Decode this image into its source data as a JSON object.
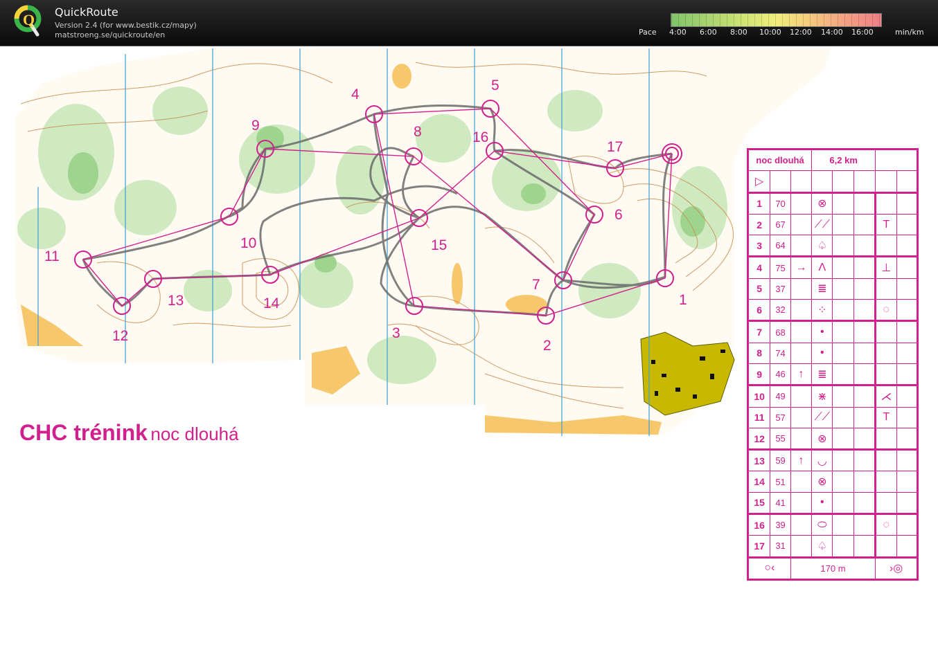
{
  "app": {
    "name": "QuickRoute",
    "version": "Version 2.4  (for www.bestik.cz/mapy)",
    "url": "matstroeng.se/quickroute/en"
  },
  "pace_legend": {
    "label": "Pace",
    "ticks": [
      "4:00",
      "6:00",
      "8:00",
      "10:00",
      "12:00",
      "14:00",
      "16:00"
    ],
    "unit": "min/km",
    "colors": [
      "#7fc46a",
      "#a7d36f",
      "#cde474",
      "#f1ee7c",
      "#f6c97e",
      "#f3a083",
      "#ee7f86"
    ]
  },
  "map": {
    "title_main": "CHC trénink",
    "title_sub": "noc dlouhá",
    "course_color": "#d11f8d",
    "controls": [
      "1",
      "2",
      "3",
      "4",
      "5",
      "6",
      "7",
      "8",
      "9",
      "10",
      "11",
      "12",
      "13",
      "14",
      "15",
      "16",
      "17"
    ]
  },
  "description": {
    "course_name": "noc dlouhá",
    "length": "6,2 km",
    "start_symbol": "▷",
    "rows": [
      {
        "n": "1",
        "code": "70",
        "dir": "",
        "feature": "⊗",
        "detail": ""
      },
      {
        "n": "2",
        "code": "67",
        "dir": "",
        "feature": "⟋⟋",
        "detail": "T"
      },
      {
        "n": "3",
        "code": "64",
        "dir": "",
        "feature": "♤",
        "detail": ""
      },
      {
        "n": "4",
        "code": "75",
        "dir": "→",
        "feature": "Λ",
        "detail": "⊥"
      },
      {
        "n": "5",
        "code": "37",
        "dir": "",
        "feature": "≣",
        "detail": ""
      },
      {
        "n": "6",
        "code": "32",
        "dir": "",
        "feature": "⁘",
        "detail": "◌"
      },
      {
        "n": "7",
        "code": "68",
        "dir": "",
        "feature": "•",
        "detail": ""
      },
      {
        "n": "8",
        "code": "74",
        "dir": "",
        "feature": "•",
        "detail": ""
      },
      {
        "n": "9",
        "code": "46",
        "dir": "↑",
        "feature": "≣",
        "detail": ""
      },
      {
        "n": "10",
        "code": "49",
        "dir": "",
        "feature": "⋇",
        "detail": "⋌"
      },
      {
        "n": "11",
        "code": "57",
        "dir": "",
        "feature": "⟋⟋",
        "detail": "T"
      },
      {
        "n": "12",
        "code": "55",
        "dir": "",
        "feature": "⊗",
        "detail": ""
      },
      {
        "n": "13",
        "code": "59",
        "dir": "↑",
        "feature": "◡",
        "detail": ""
      },
      {
        "n": "14",
        "code": "51",
        "dir": "",
        "feature": "⊗",
        "detail": ""
      },
      {
        "n": "15",
        "code": "41",
        "dir": "",
        "feature": "•",
        "detail": ""
      },
      {
        "n": "16",
        "code": "39",
        "dir": "",
        "feature": "⬭",
        "detail": "◌"
      },
      {
        "n": "17",
        "code": "31",
        "dir": "",
        "feature": "♤",
        "detail": ""
      }
    ],
    "finish_distance": "170 m",
    "finish_left": "○‹",
    "finish_right": "›◎"
  }
}
